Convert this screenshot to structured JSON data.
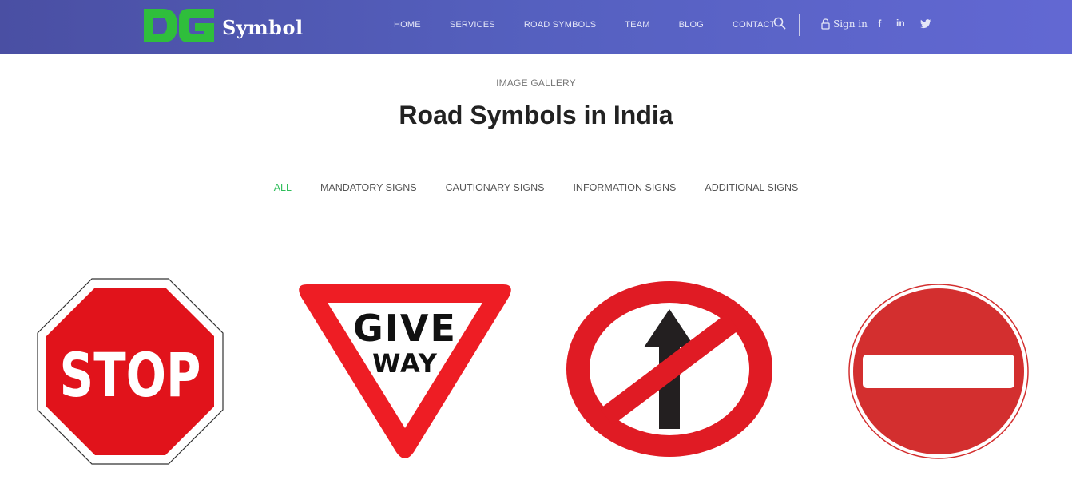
{
  "brand": {
    "mark": "DG",
    "name": "Symbol",
    "mark_color": "#2fbe3c"
  },
  "nav": {
    "items": [
      "HOME",
      "SERVICES",
      "ROAD SYMBOLS",
      "TEAM",
      "BLOG",
      "CONTACT"
    ],
    "sign_in": "Sign in",
    "social": [
      "f",
      "in",
      "twitter"
    ]
  },
  "gallery": {
    "eyebrow": "IMAGE GALLERY",
    "title": "Road Symbols in India",
    "filters": [
      "ALL",
      "MANDATORY SIGNS",
      "CAUTIONARY SIGNS",
      "INFORMATION SIGNS",
      "ADDITIONAL SIGNS"
    ],
    "active_filter": "ALL",
    "signs": [
      {
        "name": "stop-sign",
        "text": "STOP"
      },
      {
        "name": "give-way-sign",
        "line1": "GIVE",
        "line2": "WAY"
      },
      {
        "name": "no-straight-ahead-sign"
      },
      {
        "name": "no-entry-sign"
      }
    ]
  },
  "colors": {
    "accent": "#2fbe5b",
    "header_start": "#4a4fa3",
    "header_end": "#6268d3",
    "sign_red": "#e01b24"
  }
}
